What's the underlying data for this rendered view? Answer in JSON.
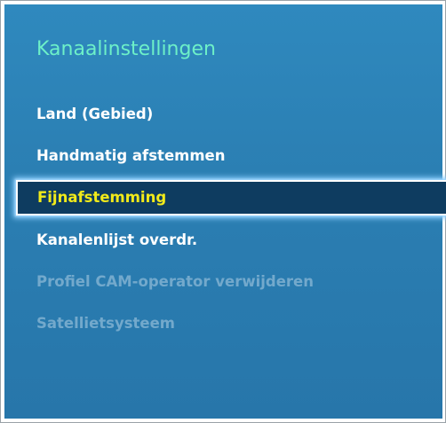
{
  "menu": {
    "title": "Kanaalinstellingen",
    "items": [
      {
        "label": "Land (Gebied)",
        "state": "enabled"
      },
      {
        "label": "Handmatig afstemmen",
        "state": "enabled"
      },
      {
        "label": "Fijnafstemming",
        "state": "selected"
      },
      {
        "label": "Kanalenlijst overdr.",
        "state": "enabled"
      },
      {
        "label": "Profiel CAM-operator verwijderen",
        "state": "disabled"
      },
      {
        "label": "Satellietsysteem",
        "state": "disabled"
      }
    ]
  },
  "colors": {
    "panel_background": "#2b7fb3",
    "title_text": "#6df0c8",
    "item_text": "#ffffff",
    "selected_background": "#0e3c60",
    "selected_text": "#f1ea1a",
    "disabled_text": "#73a9cc"
  }
}
